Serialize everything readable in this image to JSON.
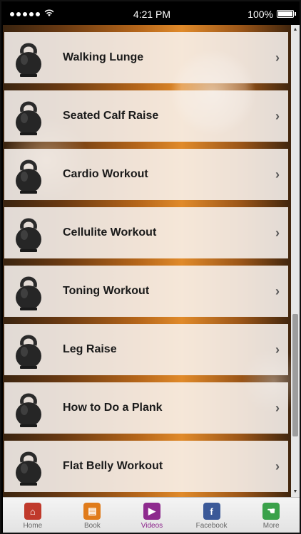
{
  "status_bar": {
    "time": "4:21 PM",
    "battery": "100%"
  },
  "list": {
    "items": [
      {
        "label": "Walking Lunge"
      },
      {
        "label": "Seated Calf Raise"
      },
      {
        "label": "Cardio Workout"
      },
      {
        "label": "Cellulite Workout"
      },
      {
        "label": "Toning Workout"
      },
      {
        "label": "Leg Raise"
      },
      {
        "label": "How to Do a Plank"
      },
      {
        "label": "Flat Belly Workout"
      }
    ],
    "item_icon": "kettlebell-icon",
    "chevron_icon": "chevron-right-icon"
  },
  "tabs": [
    {
      "label": "Home",
      "icon": "home-icon",
      "color": "#c0392b",
      "active": false
    },
    {
      "label": "Book",
      "icon": "book-icon",
      "color": "#e07b1a",
      "active": false
    },
    {
      "label": "Videos",
      "icon": "video-icon",
      "color": "#8e2a8e",
      "active": true
    },
    {
      "label": "Facebook",
      "icon": "facebook-icon",
      "color": "#3b5998",
      "active": false
    },
    {
      "label": "More",
      "icon": "more-icon",
      "color": "#3aa14a",
      "active": false
    }
  ]
}
